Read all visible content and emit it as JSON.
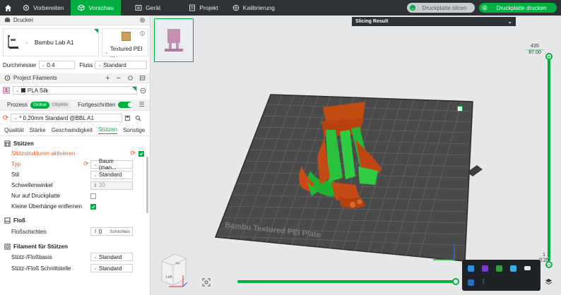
{
  "topbar": {
    "tabs": [
      {
        "label": "Vorbereiten",
        "icon": "prepare-icon"
      },
      {
        "label": "Vorschau",
        "icon": "preview-icon",
        "active": true
      },
      {
        "label": "Gerät",
        "icon": "device-icon"
      },
      {
        "label": "Projekt",
        "icon": "project-icon"
      },
      {
        "label": "Kalibrierung",
        "icon": "calibration-icon"
      }
    ],
    "slice_button": "Druckplatte slicen",
    "print_button": "Druckplatte drucken"
  },
  "printer": {
    "header": "Drucker",
    "name": "Bambu Lab A1",
    "plate": "Textured PEI ...",
    "nozzle_label": "Durchmesser",
    "nozzle_value": "0.4",
    "flow_label": "Fluss",
    "flow_value": "Standard"
  },
  "filaments": {
    "header": "Project Filaments",
    "items": [
      {
        "num": "1",
        "name": "PLA Silk",
        "color": "#e3b7d6"
      }
    ]
  },
  "process": {
    "label": "Prozess",
    "seg_global": "Global",
    "seg_objects": "Objekte",
    "advanced_label": "Fortgeschritten",
    "preset": "* 0.20mm Standard @BBL A1",
    "tabs": [
      "Qualität",
      "Stärke",
      "Geschwindigkeit",
      "Stützen",
      "Sonstige"
    ],
    "selected_tab": "Stützen"
  },
  "supports": {
    "title": "Stützen",
    "enable_label": "Stützstrukturen aktivieren",
    "type_label": "Typ",
    "type_value": "Baum (man...",
    "style_label": "Stil",
    "style_value": "Standard",
    "threshold_label": "Schwellenwinkel",
    "threshold_value": "30",
    "buildplate_only_label": "Nur auf Druckplatte",
    "remove_small_label": "Kleine Überhänge entfernen"
  },
  "raft": {
    "title": "Floß",
    "layers_label": "Floßschichten",
    "layers_value": "0",
    "layers_unit": "Schichten"
  },
  "support_filament": {
    "title": "Filament für Stützen",
    "base_label": "Stütz-/Floßbasis",
    "base_value": "Standard",
    "interface_label": "Stütz-/Floß Schnittstelle",
    "interface_value": "Standard"
  },
  "viewport": {
    "plate_number": "1",
    "slicing_result": "Slicing Result",
    "layer_top": "435",
    "height_top": "87.00",
    "layer_bottom": "1",
    "height_bottom": "0.20",
    "plate_text": "Bambu Textured PEI Plate",
    "cube_left": "Left",
    "cube_front": "Front",
    "cube_top": "Top"
  }
}
